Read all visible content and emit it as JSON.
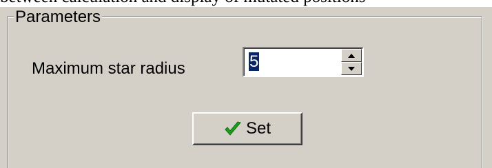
{
  "top_strip": {
    "text": "between calculation and display of mutated positions"
  },
  "group": {
    "title": "Parameters"
  },
  "max_star_radius": {
    "label": "Maximum star radius",
    "value": "5"
  },
  "set_button": {
    "label": "Set",
    "icon": "checkmark-icon",
    "icon_color": "#1aa01a"
  },
  "colors": {
    "background": "#d4d0c8",
    "selection": "#0a246a"
  }
}
